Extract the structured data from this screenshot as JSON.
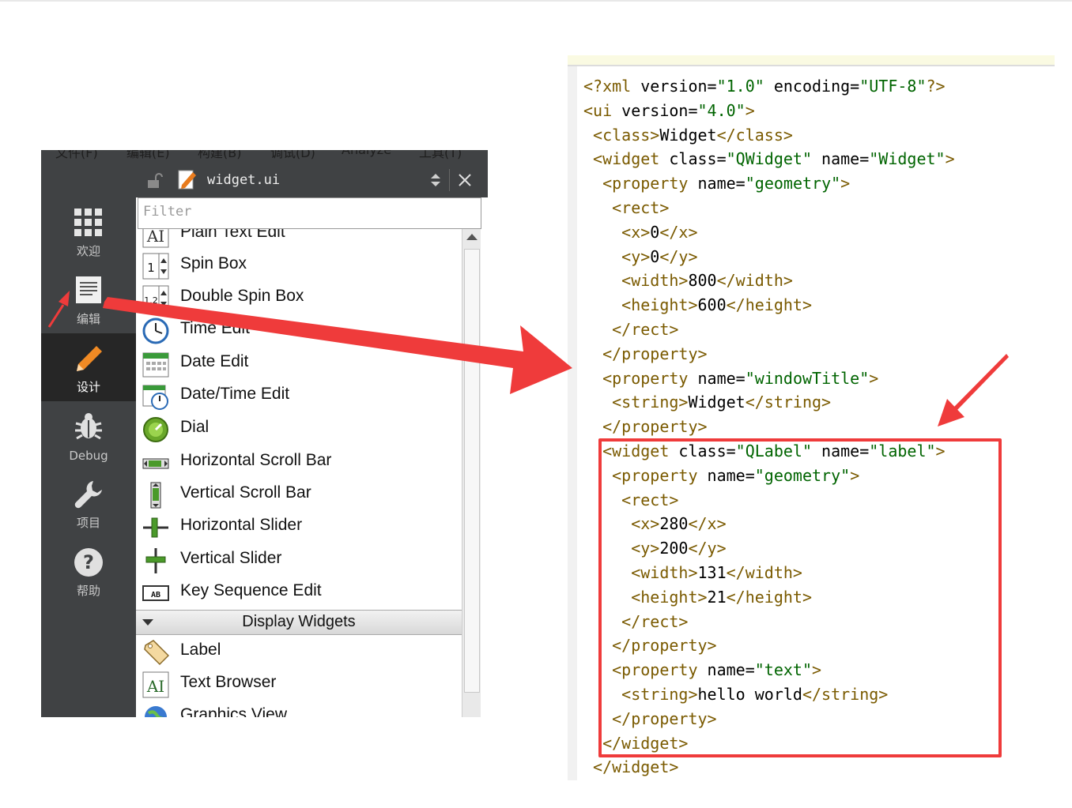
{
  "qt_creator": {
    "menu_fragments": [
      "文件(F)",
      "编辑(E)",
      "构建(B)",
      "调试(D)",
      "Analyze",
      "工具(T)"
    ],
    "modes": [
      {
        "label": "欢迎",
        "icon": "grid-icon"
      },
      {
        "label": "编辑",
        "icon": "document-icon"
      },
      {
        "label": "设计",
        "icon": "pencil-icon",
        "active": true
      },
      {
        "label": "Debug",
        "icon": "bug-icon"
      },
      {
        "label": "项目",
        "icon": "wrench-icon"
      },
      {
        "label": "帮助",
        "icon": "help-icon"
      }
    ],
    "editor_file": "widget.ui",
    "filter_placeholder": "Filter",
    "widget_items": [
      {
        "label": "Plain Text Edit",
        "icon": "plain-text-edit-icon"
      },
      {
        "label": "Spin Box",
        "icon": "spin-box-icon"
      },
      {
        "label": "Double Spin Box",
        "icon": "double-spin-box-icon"
      },
      {
        "label": "Time Edit",
        "icon": "time-edit-icon"
      },
      {
        "label": "Date Edit",
        "icon": "date-edit-icon"
      },
      {
        "label": "Date/Time Edit",
        "icon": "datetime-edit-icon"
      },
      {
        "label": "Dial",
        "icon": "dial-icon"
      },
      {
        "label": "Horizontal Scroll Bar",
        "icon": "hscrollbar-icon"
      },
      {
        "label": "Vertical Scroll Bar",
        "icon": "vscrollbar-icon"
      },
      {
        "label": "Horizontal Slider",
        "icon": "hslider-icon"
      },
      {
        "label": "Vertical Slider",
        "icon": "vslider-icon"
      },
      {
        "label": "Key Sequence Edit",
        "icon": "key-sequence-icon"
      }
    ],
    "category": "Display Widgets",
    "display_items": [
      {
        "label": "Label",
        "icon": "label-tag-icon"
      },
      {
        "label": "Text Browser",
        "icon": "text-browser-icon"
      },
      {
        "label": "Graphics View",
        "icon": "graphics-view-icon"
      }
    ]
  },
  "xml_editor": {
    "lines": [
      {
        "indent": "",
        "parts": [
          [
            "t",
            "<?xml "
          ],
          [
            "x",
            "version="
          ],
          [
            "s",
            "\"1.0\""
          ],
          [
            "x",
            " encoding="
          ],
          [
            "s",
            "\"UTF-8\""
          ],
          [
            "t",
            "?>"
          ]
        ]
      },
      {
        "indent": "",
        "parts": [
          [
            "t",
            "<ui "
          ],
          [
            "x",
            "version="
          ],
          [
            "s",
            "\"4.0\""
          ],
          [
            "t",
            ">"
          ]
        ]
      },
      {
        "indent": " ",
        "parts": [
          [
            "t",
            "<class>"
          ],
          [
            "x",
            "Widget"
          ],
          [
            "t",
            "</class>"
          ]
        ]
      },
      {
        "indent": " ",
        "parts": [
          [
            "t",
            "<widget "
          ],
          [
            "x",
            "class="
          ],
          [
            "s",
            "\"QWidget\""
          ],
          [
            "x",
            " name="
          ],
          [
            "s",
            "\"Widget\""
          ],
          [
            "t",
            ">"
          ]
        ]
      },
      {
        "indent": "  ",
        "parts": [
          [
            "t",
            "<property "
          ],
          [
            "x",
            "name="
          ],
          [
            "s",
            "\"geometry\""
          ],
          [
            "t",
            ">"
          ]
        ]
      },
      {
        "indent": "   ",
        "parts": [
          [
            "t",
            "<rect>"
          ]
        ]
      },
      {
        "indent": "    ",
        "parts": [
          [
            "t",
            "<x>"
          ],
          [
            "x",
            "0"
          ],
          [
            "t",
            "</x>"
          ]
        ]
      },
      {
        "indent": "    ",
        "parts": [
          [
            "t",
            "<y>"
          ],
          [
            "x",
            "0"
          ],
          [
            "t",
            "</y>"
          ]
        ]
      },
      {
        "indent": "    ",
        "parts": [
          [
            "t",
            "<width>"
          ],
          [
            "x",
            "800"
          ],
          [
            "t",
            "</width>"
          ]
        ]
      },
      {
        "indent": "    ",
        "parts": [
          [
            "t",
            "<height>"
          ],
          [
            "x",
            "600"
          ],
          [
            "t",
            "</height>"
          ]
        ]
      },
      {
        "indent": "   ",
        "parts": [
          [
            "t",
            "</rect>"
          ]
        ]
      },
      {
        "indent": "  ",
        "parts": [
          [
            "t",
            "</property>"
          ]
        ]
      },
      {
        "indent": "  ",
        "parts": [
          [
            "t",
            "<property "
          ],
          [
            "x",
            "name="
          ],
          [
            "s",
            "\"windowTitle\""
          ],
          [
            "t",
            ">"
          ]
        ]
      },
      {
        "indent": "   ",
        "parts": [
          [
            "t",
            "<string>"
          ],
          [
            "x",
            "Widget"
          ],
          [
            "t",
            "</string>"
          ]
        ]
      },
      {
        "indent": "  ",
        "parts": [
          [
            "t",
            "</property>"
          ]
        ]
      },
      {
        "indent": "  ",
        "parts": [
          [
            "t",
            "<widget "
          ],
          [
            "x",
            "class="
          ],
          [
            "s",
            "\"QLabel\""
          ],
          [
            "x",
            " name="
          ],
          [
            "s",
            "\"label\""
          ],
          [
            "t",
            ">"
          ]
        ]
      },
      {
        "indent": "   ",
        "parts": [
          [
            "t",
            "<property "
          ],
          [
            "x",
            "name="
          ],
          [
            "s",
            "\"geometry\""
          ],
          [
            "t",
            ">"
          ]
        ]
      },
      {
        "indent": "    ",
        "parts": [
          [
            "t",
            "<rect>"
          ]
        ]
      },
      {
        "indent": "     ",
        "parts": [
          [
            "t",
            "<x>"
          ],
          [
            "x",
            "280"
          ],
          [
            "t",
            "</x>"
          ]
        ]
      },
      {
        "indent": "     ",
        "parts": [
          [
            "t",
            "<y>"
          ],
          [
            "x",
            "200"
          ],
          [
            "t",
            "</y>"
          ]
        ]
      },
      {
        "indent": "     ",
        "parts": [
          [
            "t",
            "<width>"
          ],
          [
            "x",
            "131"
          ],
          [
            "t",
            "</width>"
          ]
        ]
      },
      {
        "indent": "     ",
        "parts": [
          [
            "t",
            "<height>"
          ],
          [
            "x",
            "21"
          ],
          [
            "t",
            "</height>"
          ]
        ]
      },
      {
        "indent": "    ",
        "parts": [
          [
            "t",
            "</rect>"
          ]
        ]
      },
      {
        "indent": "   ",
        "parts": [
          [
            "t",
            "</property>"
          ]
        ]
      },
      {
        "indent": "   ",
        "parts": [
          [
            "t",
            "<property "
          ],
          [
            "x",
            "name="
          ],
          [
            "s",
            "\"text\""
          ],
          [
            "t",
            ">"
          ]
        ]
      },
      {
        "indent": "    ",
        "parts": [
          [
            "t",
            "<string>"
          ],
          [
            "x",
            "hello world"
          ],
          [
            "t",
            "</string>"
          ]
        ]
      },
      {
        "indent": "   ",
        "parts": [
          [
            "t",
            "</property>"
          ]
        ]
      },
      {
        "indent": "  ",
        "parts": [
          [
            "t",
            "</widget>"
          ]
        ]
      },
      {
        "indent": " ",
        "parts": [
          [
            "t",
            "</widget>"
          ]
        ]
      }
    ]
  },
  "colors": {
    "annotation_red": "#ef3b3b",
    "xml_tag": "#7a5a00",
    "xml_string": "#006400",
    "sidebar_bg": "#404244"
  }
}
